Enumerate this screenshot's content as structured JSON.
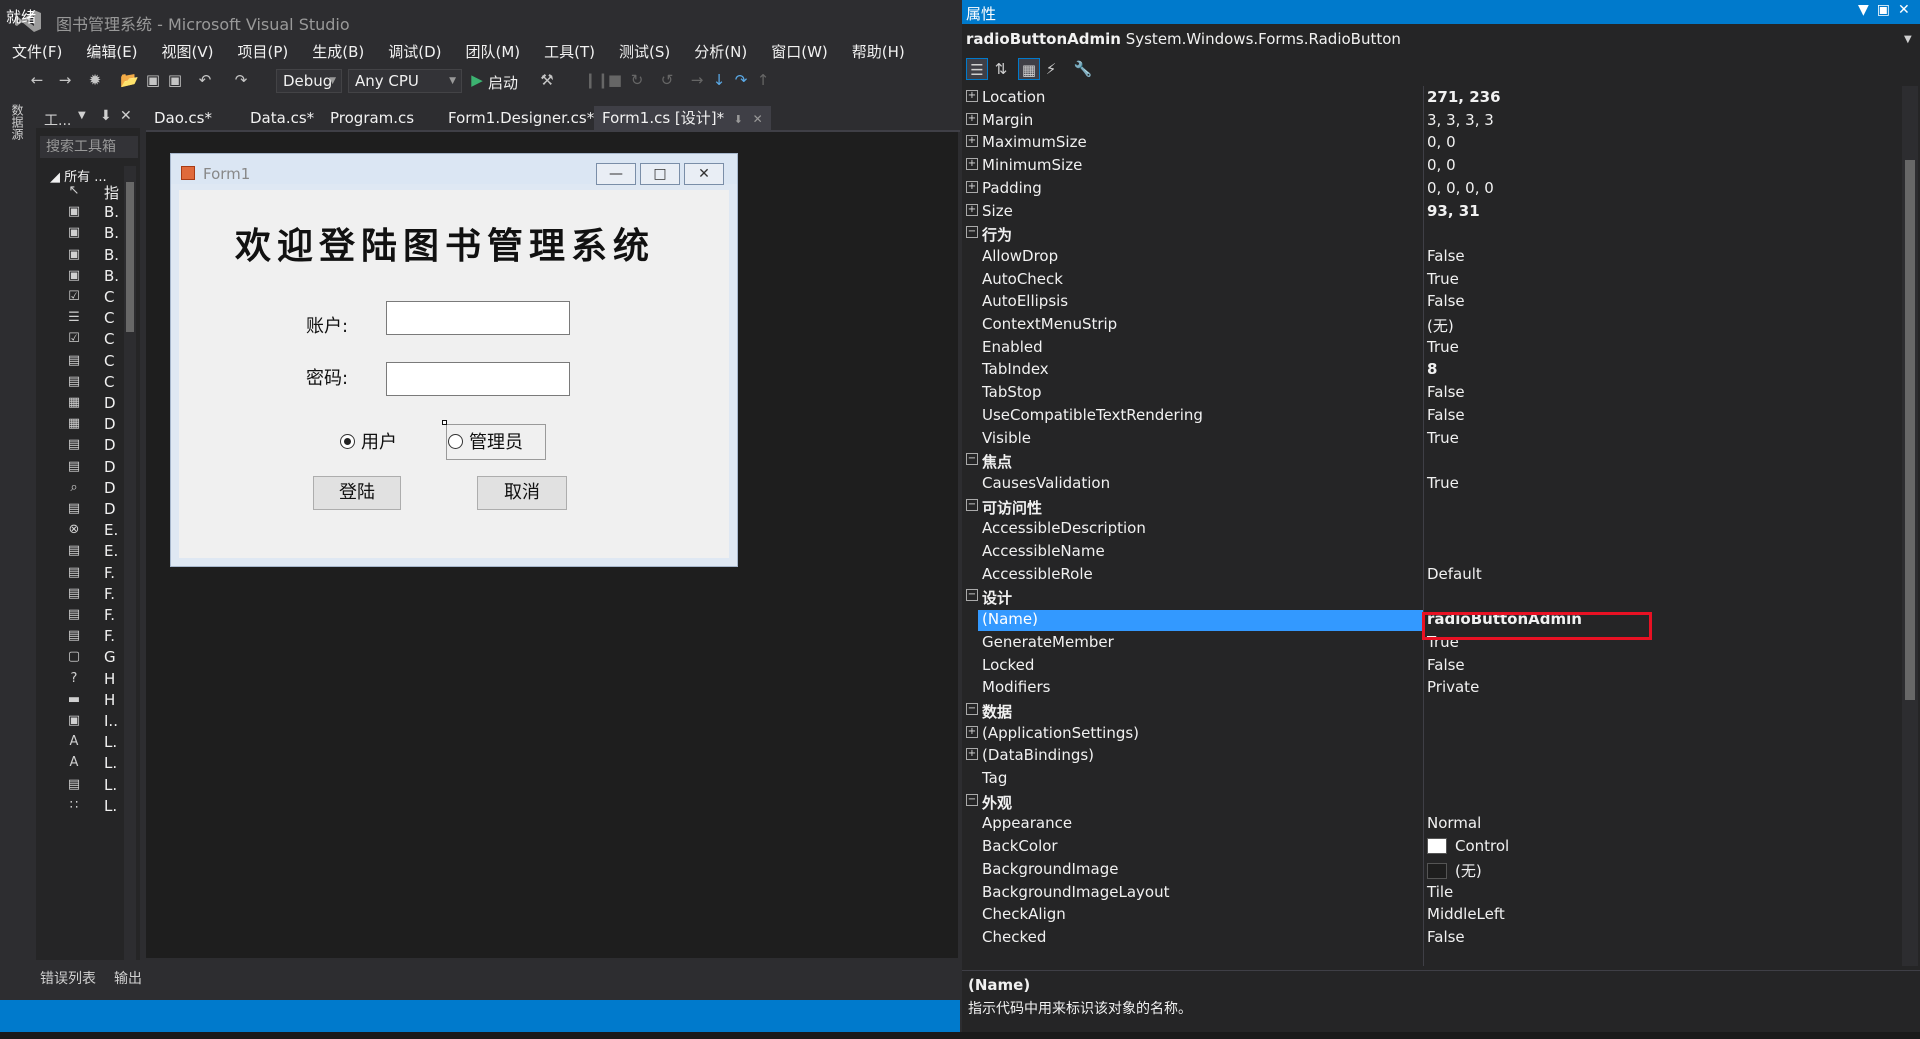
{
  "window": {
    "title": "图书管理系统 - Microsoft Visual Studio"
  },
  "menu": [
    "文件(F)",
    "编辑(E)",
    "视图(V)",
    "项目(P)",
    "生成(B)",
    "调试(D)",
    "团队(M)",
    "工具(T)",
    "测试(S)",
    "分析(N)",
    "窗口(W)",
    "帮助(H)"
  ],
  "toolbar": {
    "config": "Debug",
    "platform": "Any CPU",
    "start_label": "启动"
  },
  "left_strip": {
    "datasource_tab": "数据源"
  },
  "toolbox": {
    "title": "工...",
    "search_placeholder": "搜索工具箱",
    "group": "所有 ...",
    "items": [
      "指",
      "B.",
      "B.",
      "B.",
      "B.",
      "C",
      "C",
      "C",
      "C",
      "C",
      "D",
      "D",
      "D",
      "D",
      "D",
      "D",
      "E.",
      "E.",
      "F.",
      "F.",
      "F.",
      "F.",
      "G",
      "H",
      "H",
      "I..",
      "L.",
      "L.",
      "L.",
      "L."
    ]
  },
  "doc_tabs": [
    "Dao.cs*",
    "Data.cs*",
    "Program.cs",
    "Form1.Designer.cs*",
    "Form1.cs [设计]*"
  ],
  "form": {
    "title": "Form1",
    "heading": "欢迎登陆图书管理系统",
    "account_label": "账户:",
    "password_label": "密码:",
    "radio_user": "用户",
    "radio_admin": "管理员",
    "login_button": "登陆",
    "cancel_button": "取消"
  },
  "bottom_tabs": [
    "错误列表",
    "输出"
  ],
  "status": "就绪",
  "properties": {
    "panel_title": "属性",
    "object_name": "radioButtonAdmin",
    "object_type": "System.Windows.Forms.RadioButton",
    "rows": [
      {
        "name": "Location",
        "value": "271, 236",
        "expand": "+",
        "bold": true
      },
      {
        "name": "Margin",
        "value": "3, 3, 3, 3",
        "expand": "+"
      },
      {
        "name": "MaximumSize",
        "value": "0, 0",
        "expand": "+"
      },
      {
        "name": "MinimumSize",
        "value": "0, 0",
        "expand": "+"
      },
      {
        "name": "Padding",
        "value": "0, 0, 0, 0",
        "expand": "+"
      },
      {
        "name": "Size",
        "value": "93, 31",
        "expand": "+",
        "bold": true
      },
      {
        "name": "行为",
        "value": "",
        "expand": "-",
        "category": true
      },
      {
        "name": "AllowDrop",
        "value": "False"
      },
      {
        "name": "AutoCheck",
        "value": "True"
      },
      {
        "name": "AutoEllipsis",
        "value": "False"
      },
      {
        "name": "ContextMenuStrip",
        "value": "(无)"
      },
      {
        "name": "Enabled",
        "value": "True"
      },
      {
        "name": "TabIndex",
        "value": "8",
        "bold": true
      },
      {
        "name": "TabStop",
        "value": "False"
      },
      {
        "name": "UseCompatibleTextRendering",
        "value": "False"
      },
      {
        "name": "Visible",
        "value": "True"
      },
      {
        "name": "焦点",
        "value": "",
        "expand": "-",
        "category": true
      },
      {
        "name": "CausesValidation",
        "value": "True"
      },
      {
        "name": "可访问性",
        "value": "",
        "expand": "-",
        "category": true
      },
      {
        "name": "AccessibleDescription",
        "value": ""
      },
      {
        "name": "AccessibleName",
        "value": ""
      },
      {
        "name": "AccessibleRole",
        "value": "Default"
      },
      {
        "name": "设计",
        "value": "",
        "expand": "-",
        "category": true
      },
      {
        "name": "(Name)",
        "value": "radioButtonAdmin",
        "bold": true,
        "selected": true
      },
      {
        "name": "GenerateMember",
        "value": "True"
      },
      {
        "name": "Locked",
        "value": "False"
      },
      {
        "name": "Modifiers",
        "value": "Private"
      },
      {
        "name": "数据",
        "value": "",
        "expand": "-",
        "category": true
      },
      {
        "name": "(ApplicationSettings)",
        "value": "",
        "expand": "+"
      },
      {
        "name": "(DataBindings)",
        "value": "",
        "expand": "+"
      },
      {
        "name": "Tag",
        "value": ""
      },
      {
        "name": "外观",
        "value": "",
        "expand": "-",
        "category": true
      },
      {
        "name": "Appearance",
        "value": "Normal"
      },
      {
        "name": "BackColor",
        "value": "Control",
        "swatch": "#ffffff"
      },
      {
        "name": "BackgroundImage",
        "value": "(无)",
        "swatch": "#1e1e1e"
      },
      {
        "name": "BackgroundImageLayout",
        "value": "Tile"
      },
      {
        "name": "CheckAlign",
        "value": "MiddleLeft"
      },
      {
        "name": "Checked",
        "value": "False"
      }
    ],
    "description_title": "(Name)",
    "description_text": "指示代码中用来标识该对象的名称。"
  }
}
